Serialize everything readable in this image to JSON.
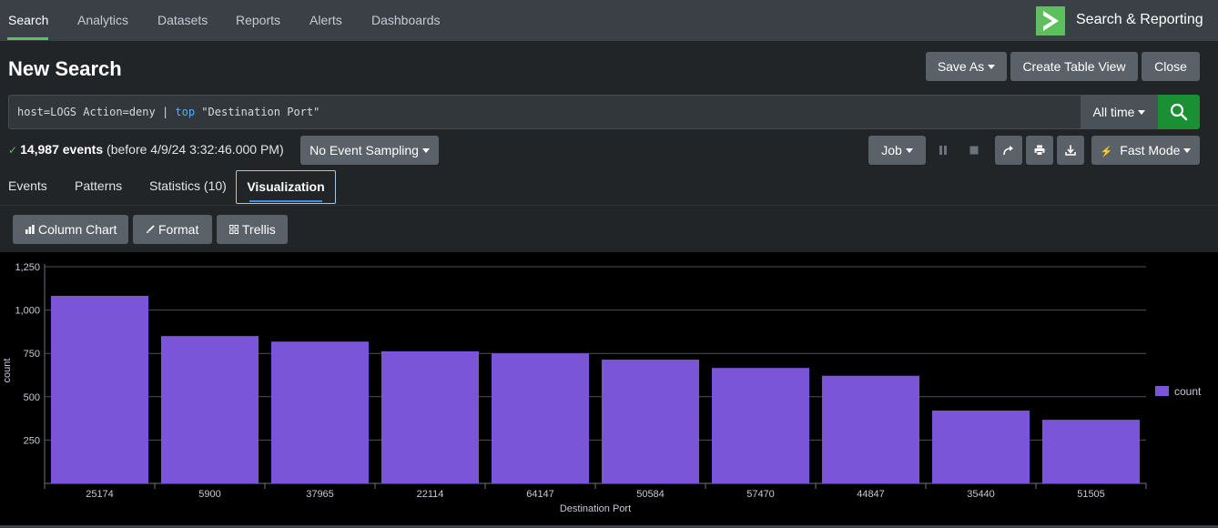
{
  "nav": {
    "items": [
      {
        "label": "Search",
        "active": true
      },
      {
        "label": "Analytics"
      },
      {
        "label": "Datasets"
      },
      {
        "label": "Reports"
      },
      {
        "label": "Alerts"
      },
      {
        "label": "Dashboards"
      }
    ],
    "app_name": "Search & Reporting",
    "logo_icon": "chevron-right-logo-icon"
  },
  "page": {
    "title": "New Search"
  },
  "actions": {
    "save_as": "Save As",
    "create_table_view": "Create Table View",
    "close": "Close"
  },
  "search": {
    "query_prefix": "host=LOGS Action=deny | ",
    "query_command": "top",
    "query_suffix": " \"Destination Port\"",
    "time_range": "All time",
    "search_icon": "magnifier-icon"
  },
  "status": {
    "event_count": "14,987 events",
    "detail": "(before 4/9/24 3:32:46.000 PM)",
    "sampling": "No Event Sampling"
  },
  "job": {
    "job_label": "Job",
    "mode_label": "Fast Mode",
    "icons": [
      "pause-icon",
      "stop-icon",
      "share-icon",
      "print-icon",
      "export-icon",
      "lightning-icon"
    ]
  },
  "tabs": [
    {
      "label": "Events"
    },
    {
      "label": "Patterns"
    },
    {
      "label": "Statistics (10)"
    },
    {
      "label": "Visualization",
      "active": true
    }
  ],
  "viz_toolbar": {
    "chart_type": "Column Chart",
    "format": "Format",
    "trellis": "Trellis"
  },
  "colors": {
    "bar": "#7a55d8",
    "accent_green": "#5cc05c",
    "search_button": "#1a9035"
  },
  "chart_data": {
    "type": "bar",
    "xlabel": "Destination Port",
    "ylabel": "count",
    "ylim": [
      0,
      1250
    ],
    "yticks": [
      "250",
      "500",
      "750",
      "1,000",
      "1,250"
    ],
    "ytick_values": [
      250,
      500,
      750,
      1000,
      1250
    ],
    "grid": true,
    "legend_position": "right",
    "categories": [
      "25174",
      "5900",
      "37965",
      "22114",
      "64147",
      "50584",
      "57470",
      "44847",
      "35440",
      "51505"
    ],
    "series": [
      {
        "name": "count",
        "values": [
          1082,
          850,
          818,
          762,
          750,
          714,
          666,
          621,
          420,
          367
        ]
      }
    ]
  }
}
